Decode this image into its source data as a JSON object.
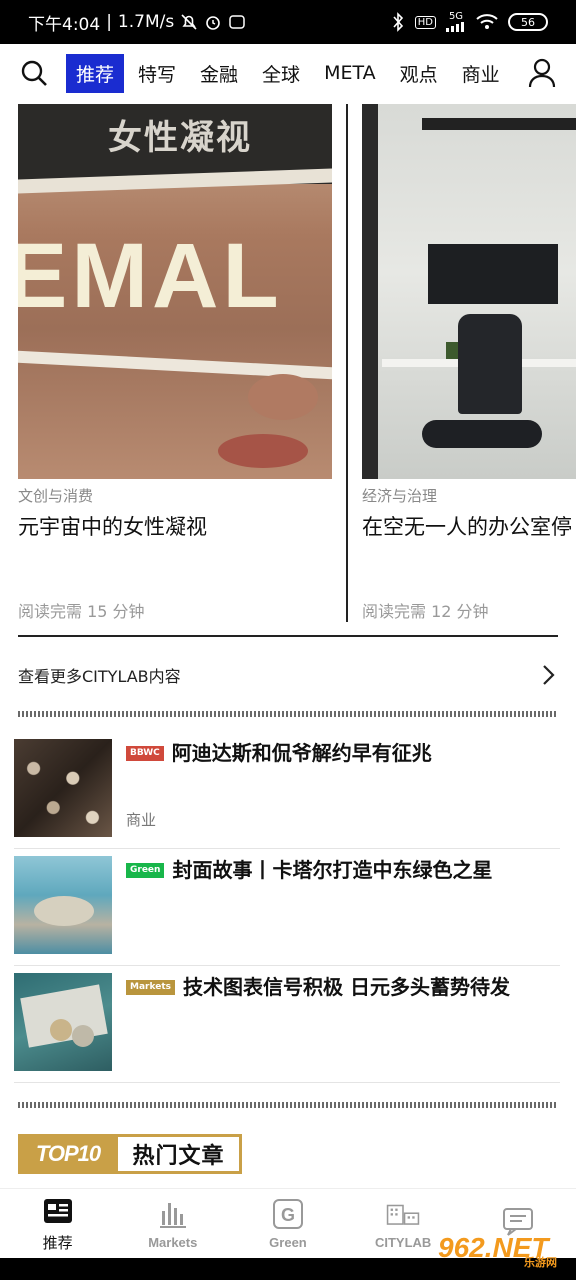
{
  "status_bar": {
    "time": "下午4:04",
    "network_speed": "1.7M/s",
    "battery": "56",
    "signal_label": "5G"
  },
  "nav": {
    "tabs": [
      "推荐",
      "特写",
      "金融",
      "全球",
      "META",
      "观点",
      "商业"
    ],
    "active_tab": "推荐"
  },
  "carousel": [
    {
      "image_text_top": "女性凝视",
      "image_text_big": "EMAL",
      "category": "文创与消费",
      "title": "元宇宙中的女性凝视",
      "read_time": "阅读完需 15 分钟"
    },
    {
      "category": "经济与治理",
      "title": "在空无一人的办公室停",
      "read_time": "阅读完需 12 分钟"
    }
  ],
  "more_link": "查看更多CITYLAB内容",
  "news": [
    {
      "tag": "BBWC",
      "tag_color": "#d0493b",
      "title": "阿迪达斯和侃爷解约早有征兆",
      "section": "商业"
    },
    {
      "tag": "Green",
      "tag_color": "#18b64a",
      "title": "封面故事丨卡塔尔打造中东绿色之星",
      "section": ""
    },
    {
      "tag": "Markets",
      "tag_color": "#b9953d",
      "title": "技术图表信号积极 日元多头蓄势待发",
      "section": ""
    }
  ],
  "top10": {
    "badge": "TOP10",
    "label": "热门文章"
  },
  "bottom_tabs": [
    {
      "label": "推荐",
      "icon": "news-icon",
      "active": true
    },
    {
      "label": "Markets",
      "icon": "bar-chart-icon",
      "active": false
    },
    {
      "label": "Green",
      "icon": "green-g-icon",
      "active": false
    },
    {
      "label": "CITYLAB",
      "icon": "city-icon",
      "active": false
    },
    {
      "label": "",
      "icon": "chat-icon",
      "active": false
    }
  ],
  "watermark": {
    "number": "962.NET",
    "sub": "乐游网"
  },
  "colors": {
    "accent": "#1a2cd0",
    "gold": "#c9a047"
  }
}
